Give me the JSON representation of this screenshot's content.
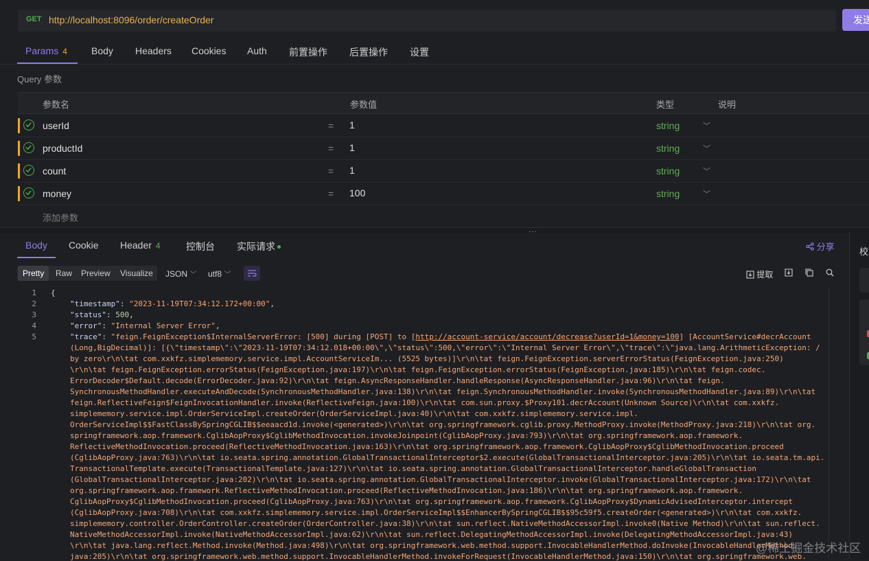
{
  "request": {
    "method": "GET",
    "url": "http://localhost:8096/order/createOrder",
    "send_label": "发送"
  },
  "request_tabs": [
    {
      "label": "Params",
      "badge": "4"
    },
    {
      "label": "Body"
    },
    {
      "label": "Headers"
    },
    {
      "label": "Cookies"
    },
    {
      "label": "Auth"
    },
    {
      "label": "前置操作"
    },
    {
      "label": "后置操作"
    },
    {
      "label": "设置"
    }
  ],
  "query_label": "Query 参数",
  "params_table": {
    "headers": [
      "参数名",
      "参数值",
      "类型",
      "说明"
    ],
    "rows": [
      {
        "name": "userId",
        "value": "1",
        "type": "string"
      },
      {
        "name": "productId",
        "value": "1",
        "type": "string"
      },
      {
        "name": "count",
        "value": "1",
        "type": "string"
      },
      {
        "name": "money",
        "value": "100",
        "type": "string"
      }
    ],
    "add_label": "添加参数",
    "eq": "="
  },
  "splitter_dots": "...",
  "response_tabs": [
    {
      "label": "Body"
    },
    {
      "label": "Cookie"
    },
    {
      "label": "Header",
      "badge": "4"
    },
    {
      "label": "控制台"
    },
    {
      "label": "实际请求"
    }
  ],
  "share_label": "分享",
  "side_panel_label": "校",
  "view_modes": [
    "Pretty",
    "Raw",
    "Preview",
    "Visualize"
  ],
  "format": {
    "type": "JSON",
    "encoding": "utf8"
  },
  "extract_label": "提取",
  "code": {
    "line_numbers": [
      "1",
      "2",
      "3",
      "4",
      "5"
    ],
    "brace": "{",
    "timestamp_key": "\"timestamp\"",
    "timestamp_val": "\"2023-11-19T07:34:12.172+00:00\"",
    "status_key": "\"status\"",
    "status_val": "500",
    "error_key": "\"error\"",
    "error_val": "\"Internal Server Error\"",
    "trace_key": "\"trace\"",
    "trace_prefix": "\"feign.FeignException$InternalServerError: [500] during [POST] to [",
    "trace_link": "http://account-service/account/decrease?userId=1&money=100",
    "trace_suffix": "] [AccountService#decrAccount",
    "trace_lines": [
      "(Long,BigDecimal)]: [{\\\"timestamp\\\":\\\"2023-11-19T07:34:12.018+00:00\\\",\\\"status\\\":500,\\\"error\\\":\\\"Internal Server Error\\\",\\\"trace\\\":\\\"java.lang.ArithmeticException: /",
      "by zero\\r\\n\\tat com.xxkfz.simplememory.service.impl.AccountServiceIm... (5525 bytes)]\\r\\n\\tat feign.FeignException.serverErrorStatus(FeignException.java:250)",
      "\\r\\n\\tat feign.FeignException.errorStatus(FeignException.java:197)\\r\\n\\tat feign.FeignException.errorStatus(FeignException.java:185)\\r\\n\\tat feign.codec.",
      "ErrorDecoder$Default.decode(ErrorDecoder.java:92)\\r\\n\\tat feign.AsyncResponseHandler.handleResponse(AsyncResponseHandler.java:96)\\r\\n\\tat feign.",
      "SynchronousMethodHandler.executeAndDecode(SynchronousMethodHandler.java:138)\\r\\n\\tat feign.SynchronousMethodHandler.invoke(SynchronousMethodHandler.java:89)\\r\\n\\tat",
      "feign.ReflectiveFeign$FeignInvocationHandler.invoke(ReflectiveFeign.java:100)\\r\\n\\tat com.sun.proxy.$Proxy101.decrAccount(Unknown Source)\\r\\n\\tat com.xxkfz.",
      "simplememory.service.impl.OrderServiceImpl.createOrder(OrderServiceImpl.java:40)\\r\\n\\tat com.xxkfz.simplememory.service.impl.",
      "OrderServiceImpl$$FastClassBySpringCGLIB$$eeaacd1d.invoke(<generated>)\\r\\n\\tat org.springframework.cglib.proxy.MethodProxy.invoke(MethodProxy.java:218)\\r\\n\\tat org.",
      "springframework.aop.framework.CglibAopProxy$CglibMethodInvocation.invokeJoinpoint(CglibAopProxy.java:793)\\r\\n\\tat org.springframework.aop.framework.",
      "ReflectiveMethodInvocation.proceed(ReflectiveMethodInvocation.java:163)\\r\\n\\tat org.springframework.aop.framework.CglibAopProxy$CglibMethodInvocation.proceed",
      "(CglibAopProxy.java:763)\\r\\n\\tat io.seata.spring.annotation.GlobalTransactionalInterceptor$2.execute(GlobalTransactionalInterceptor.java:205)\\r\\n\\tat io.seata.tm.api.",
      "TransactionalTemplate.execute(TransactionalTemplate.java:127)\\r\\n\\tat io.seata.spring.annotation.GlobalTransactionalInterceptor.handleGlobalTransaction",
      "(GlobalTransactionalInterceptor.java:202)\\r\\n\\tat io.seata.spring.annotation.GlobalTransactionalInterceptor.invoke(GlobalTransactionalInterceptor.java:172)\\r\\n\\tat",
      "org.springframework.aop.framework.ReflectiveMethodInvocation.proceed(ReflectiveMethodInvocation.java:186)\\r\\n\\tat org.springframework.aop.framework.",
      "CglibAopProxy$CglibMethodInvocation.proceed(CglibAopProxy.java:763)\\r\\n\\tat org.springframework.aop.framework.CglibAopProxy$DynamicAdvisedInterceptor.intercept",
      "(CglibAopProxy.java:708)\\r\\n\\tat com.xxkfz.simplememory.service.impl.OrderServiceImpl$$EnhancerBySpringCGLIB$$95c59f5.createOrder(<generated>)\\r\\n\\tat com.xxkfz.",
      "simplememory.controller.OrderController.createOrder(OrderController.java:38)\\r\\n\\tat sun.reflect.NativeMethodAccessorImpl.invoke0(Native Method)\\r\\n\\tat sun.reflect.",
      "NativeMethodAccessorImpl.invoke(NativeMethodAccessorImpl.java:62)\\r\\n\\tat sun.reflect.DelegatingMethodAccessorImpl.invoke(DelegatingMethodAccessorImpl.java:43)",
      "\\r\\n\\tat java.lang.reflect.Method.invoke(Method.java:498)\\r\\n\\tat org.springframework.web.method.support.InvocableHandlerMethod.doInvoke(InvocableHandlerMethod.",
      "java:205)\\r\\n\\tat org.springframework.web.method.support.InvocableHandlerMethod.invokeForRequest(InvocableHandlerMethod.java:150)\\r\\n\\tat org.springframework.web."
    ]
  },
  "watermark": "@稀土掘金技术社区",
  "colors": {
    "accent": "#8f7ce6",
    "method_get": "#4caf50",
    "url": "#e8b14a",
    "param_bar": "#f5a623",
    "type_string": "#5fae57",
    "json_string": "#f3a77a"
  }
}
